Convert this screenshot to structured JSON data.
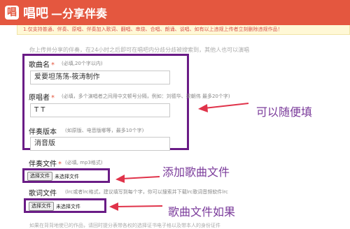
{
  "header": {
    "logo_char": "唱",
    "brand": "唱吧",
    "subtitle": "—分享伴奏"
  },
  "warning": "1.仅支持普通、伴奏、原唱、伴奏加入歌词、翻唱、串烧、合唱、朗诵、谈唱、如有以上违规上传者立刻删除违规作品！",
  "intro": "你上传并分享的伴奏，在24小时之后即可在唱吧内分歧分歧被搜索到，其他人也可以演唱",
  "form": {
    "song_name": {
      "label": "歌曲名",
      "required": "*",
      "hint": "(必填,20个字以内)",
      "value": "爱要坦荡荡-筱涛制作"
    },
    "singer": {
      "label": "原唱者",
      "required": "*",
      "hint": "(必填，多个演唱者之间用中文顿号分隔，例如：刘德华、梁朝伟 最多20个字)",
      "value": "T T"
    },
    "version": {
      "label": "伴奏版本",
      "hint": "(如原版、电音版哪等，最多10个字)",
      "value": "消音版"
    },
    "accomp_file": {
      "label": "伴奏文件",
      "required": "*",
      "hint": "(必填, mp3格式)",
      "button": "选择文件",
      "status": "未选择文件"
    },
    "lyric_file": {
      "label": "歌词文件",
      "hint": "(lrc或者lrc格式，建议填写到每个字，你可以搜索并下载lrc歌词音频软件lrc",
      "button": "选择文件",
      "status": "未选择文件"
    }
  },
  "annotations": {
    "fill_freely": "可以随便填",
    "add_song_file": "添加歌曲文件",
    "song_file_if": "歌曲文件如果"
  },
  "footer_note": "如果在背背地使已的作品，请回时提分表带各权的选择证书电子格以及带本人的身份证件",
  "colors": {
    "header": "#e4573f",
    "annotation_box": "#6a1c86",
    "arrow": "#e0334a"
  }
}
